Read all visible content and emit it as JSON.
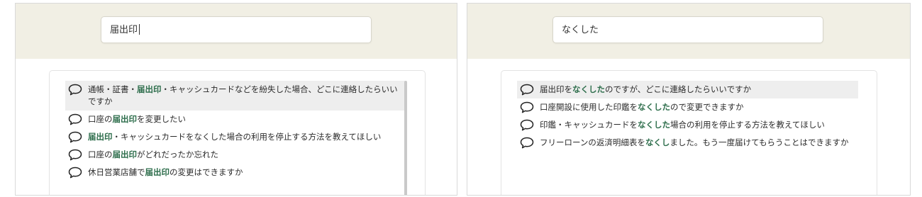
{
  "left": {
    "search": {
      "value": "届出印"
    },
    "suggestions": [
      {
        "parts": [
          {
            "t": "通帳・証書・"
          },
          {
            "t": "届出印",
            "h": true
          },
          {
            "t": "・キャッシュカードなどを紛失した場合、どこに連絡したらいいですか"
          }
        ],
        "highlighted": true
      },
      {
        "parts": [
          {
            "t": "口座の"
          },
          {
            "t": "届出印",
            "h": true
          },
          {
            "t": "を変更したい"
          }
        ]
      },
      {
        "parts": [
          {
            "t": "届出印",
            "h": true
          },
          {
            "t": "・キャッシュカードをなくした場合の利用を停止する方法を教えてほしい"
          }
        ]
      },
      {
        "parts": [
          {
            "t": "口座の"
          },
          {
            "t": "届出印",
            "h": true
          },
          {
            "t": "がどれだったか忘れた"
          }
        ]
      },
      {
        "parts": [
          {
            "t": "休日営業店舗で"
          },
          {
            "t": "届出印",
            "h": true
          },
          {
            "t": "の変更はできますか"
          }
        ]
      }
    ]
  },
  "right": {
    "search": {
      "value": "なくした"
    },
    "suggestions": [
      {
        "parts": [
          {
            "t": "届出印を"
          },
          {
            "t": "なくした",
            "h": true
          },
          {
            "t": "のですが、どこに連絡したらいいですか"
          }
        ],
        "highlighted": true
      },
      {
        "parts": [
          {
            "t": "口座開設に使用した印鑑を"
          },
          {
            "t": "なくした",
            "h": true
          },
          {
            "t": "ので変更できますか"
          }
        ]
      },
      {
        "parts": [
          {
            "t": "印鑑・キャッシュカードを"
          },
          {
            "t": "なくした",
            "h": true
          },
          {
            "t": "場合の利用を停止する方法を教えてほしい"
          }
        ]
      },
      {
        "parts": [
          {
            "t": "フリーローンの返済明細表を"
          },
          {
            "t": "なくし",
            "h": true
          },
          {
            "t": "ました。もう一度届けてもらうことはできますか"
          }
        ]
      }
    ]
  },
  "colors": {
    "search_bg": "#f1efe4",
    "highlight_text": "#2e6e4c",
    "selected_row": "#eeeeee"
  },
  "icons": {
    "suggestion": "speech-bubble-icon"
  }
}
